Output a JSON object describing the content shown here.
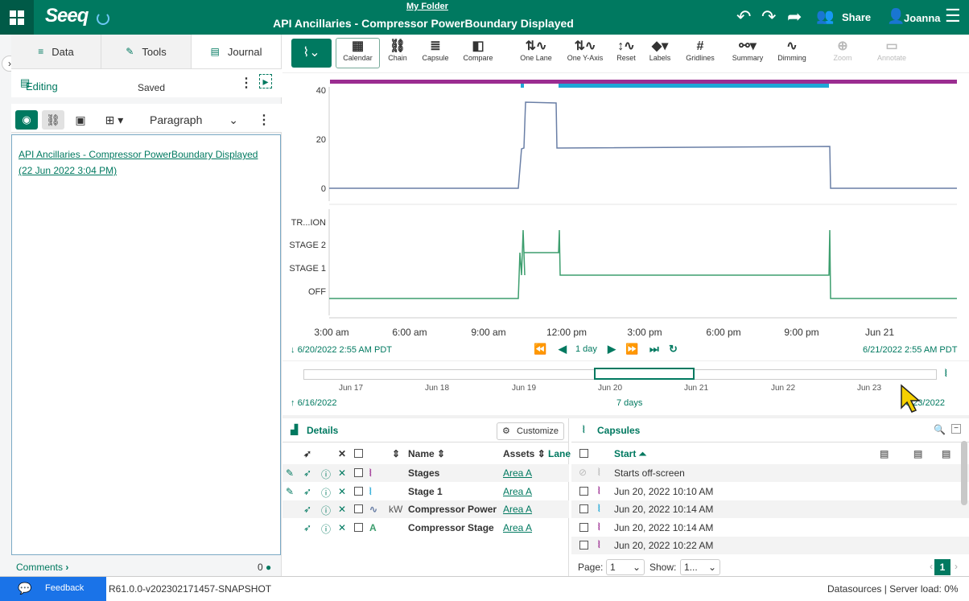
{
  "header": {
    "folder": "My Folder",
    "title": "API Ancillaries - Compressor PowerBoundary Displayed",
    "logo": "Seeq",
    "share_label": "Share",
    "user_name": "Joanna"
  },
  "left_panel": {
    "tabs": [
      {
        "label": "Data",
        "icon": "database-icon"
      },
      {
        "label": "Tools",
        "icon": "wrench-icon"
      },
      {
        "label": "Journal",
        "icon": "book-icon"
      }
    ],
    "editing_label": "Editing",
    "saved_label": "Saved",
    "paragraph_label": "Paragraph",
    "journal_link_line1": "API Ancillaries - Compressor PowerBoundary Displayed",
    "journal_link_line2": "(22 Jun 2022 3:04 PM)",
    "comments_label": "Comments",
    "comments_count": "0"
  },
  "toolbar": {
    "tools": [
      {
        "label": "Calendar",
        "enabled": true
      },
      {
        "label": "Chain",
        "enabled": true
      },
      {
        "label": "Capsule",
        "enabled": true
      },
      {
        "label": "Compare",
        "enabled": true
      },
      {
        "label": "One Lane",
        "enabled": true
      },
      {
        "label": "One Y-Axis",
        "enabled": true
      },
      {
        "label": "Reset",
        "enabled": true
      },
      {
        "label": "Labels",
        "enabled": true
      },
      {
        "label": "Gridlines",
        "enabled": true
      },
      {
        "label": "Summary",
        "enabled": true
      },
      {
        "label": "Dimming",
        "enabled": true
      },
      {
        "label": "Zoom",
        "enabled": false
      },
      {
        "label": "Annotate",
        "enabled": false
      }
    ]
  },
  "trend": {
    "y1_ticks": [
      "40",
      "20",
      "0"
    ],
    "y2_ticks": [
      "TR...ION",
      "STAGE 2",
      "STAGE 1",
      "OFF"
    ],
    "x_ticks": [
      "3:00 am",
      "6:00 am",
      "9:00 am",
      "12:00 pm",
      "3:00 pm",
      "6:00 pm",
      "9:00 pm",
      "Jun 21"
    ],
    "start_time": "6/20/2022 2:55 AM",
    "timezone": "PDT",
    "end_time": "6/21/2022 2:55 AM PDT",
    "duration": "1 day",
    "colors": {
      "purple": "#9b2d91",
      "blue": "#1fa7d6",
      "signal": "#6a7fa6",
      "stage": "#3d9e6e"
    }
  },
  "overview": {
    "ticks": [
      "Jun 17",
      "Jun 18",
      "Jun 19",
      "Jun 20",
      "Jun 21",
      "Jun 22",
      "Jun 23"
    ],
    "start_date": "6/16/2022",
    "end_date": "6/23/2022",
    "duration": "7 days"
  },
  "details": {
    "title": "Details",
    "customize_label": "Customize",
    "columns": {
      "name": "Name",
      "assets": "Assets",
      "lane": "Lane"
    },
    "rows": [
      {
        "name": "Stages",
        "unit": "",
        "asset": "Area A"
      },
      {
        "name": "Stage 1",
        "unit": "",
        "asset": "Area A"
      },
      {
        "name": "Compressor Power",
        "unit": "kW",
        "asset": "Area A"
      },
      {
        "name": "Compressor Stage",
        "unit": "",
        "asset": "Area A"
      }
    ]
  },
  "capsules": {
    "title": "Capsules",
    "start_header": "Start",
    "rows": [
      {
        "start": "Starts off-screen"
      },
      {
        "start": "Jun 20, 2022 10:10 AM"
      },
      {
        "start": "Jun 20, 2022 10:14 AM"
      },
      {
        "start": "Jun 20, 2022 10:14 AM"
      },
      {
        "start": "Jun 20, 2022 10:22 AM"
      }
    ],
    "page_label": "Page:",
    "page_value": "1",
    "show_label": "Show:",
    "show_value": "1...",
    "current_page": "1"
  },
  "footer": {
    "feedback": "Feedback",
    "version": "R61.0.0-v202302171457-SNAPSHOT",
    "datasources": "Datasources",
    "server_load": "Server load: 0%"
  }
}
